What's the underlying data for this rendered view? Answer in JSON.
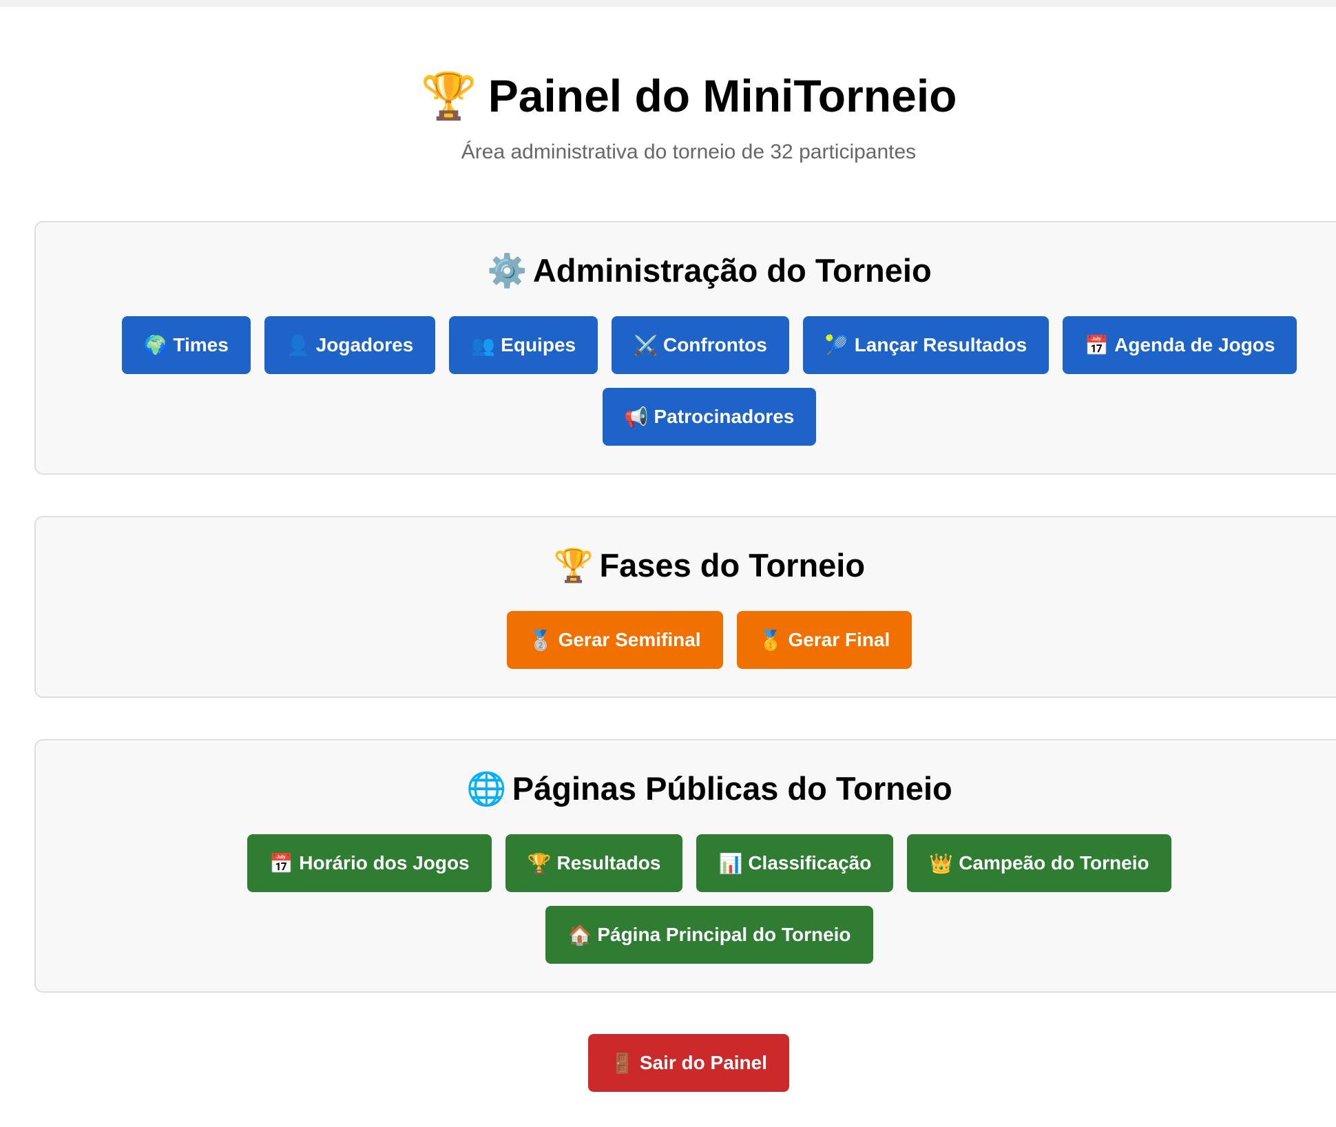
{
  "header": {
    "title_emoji": "🏆",
    "title": "Painel do MiniTorneio",
    "subtitle": "Área administrativa do torneio de 32 participantes"
  },
  "sections": {
    "admin": {
      "emoji": "⚙️",
      "title": "Administração do Torneio",
      "buttons": [
        {
          "emoji": "🌍",
          "label": "Times",
          "icon": "globe-icon"
        },
        {
          "emoji": "👤",
          "label": "Jogadores",
          "icon": "person-icon"
        },
        {
          "emoji": "👥",
          "label": "Equipes",
          "icon": "people-icon"
        },
        {
          "emoji": "⚔️",
          "label": "Confrontos",
          "icon": "crossed-swords-icon"
        },
        {
          "emoji": "🎾",
          "label": "Lançar Resultados",
          "icon": "tennis-ball-icon"
        },
        {
          "emoji": "📅",
          "label": "Agenda de Jogos",
          "icon": "calendar-icon"
        },
        {
          "emoji": "📢",
          "label": "Patrocinadores",
          "icon": "megaphone-icon"
        }
      ]
    },
    "fases": {
      "emoji": "🏆",
      "title": "Fases do Torneio",
      "buttons": [
        {
          "emoji": "🥈",
          "label": "Gerar Semifinal",
          "icon": "silver-medal-icon"
        },
        {
          "emoji": "🥇",
          "label": "Gerar Final",
          "icon": "gold-medal-icon"
        }
      ]
    },
    "publicas": {
      "emoji": "🌐",
      "title": "Páginas Públicas do Torneio",
      "buttons": [
        {
          "emoji": "📅",
          "label": "Horário dos Jogos",
          "icon": "calendar-icon"
        },
        {
          "emoji": "🏆",
          "label": "Resultados",
          "icon": "trophy-icon"
        },
        {
          "emoji": "📊",
          "label": "Classificação",
          "icon": "bar-chart-icon"
        },
        {
          "emoji": "👑",
          "label": "Campeão do Torneio",
          "icon": "crown-icon"
        },
        {
          "emoji": "🏠",
          "label": "Página Principal do Torneio",
          "icon": "house-icon"
        }
      ]
    }
  },
  "logout": {
    "emoji": "🚪",
    "label": "Sair do Painel",
    "icon": "door-icon"
  },
  "colors": {
    "admin_buttons": "#1e64c8",
    "phase_buttons": "#f07000",
    "public_buttons": "#2f7d33",
    "logout_button": "#cc2a2a",
    "section_background": "#f8f8f8",
    "subtitle": "#666666"
  }
}
